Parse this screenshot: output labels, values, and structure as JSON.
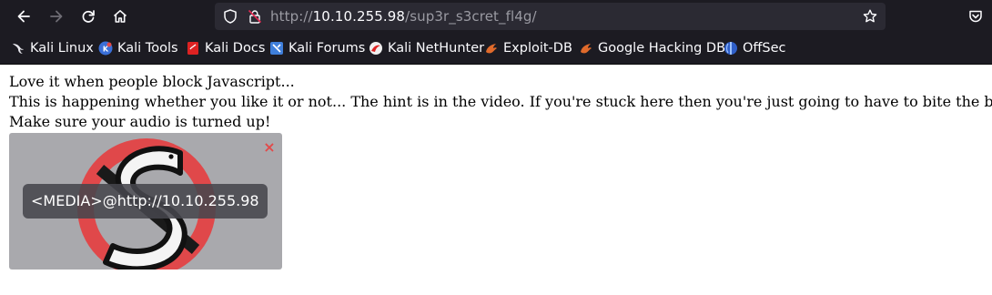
{
  "browser": {
    "url": {
      "scheme": "http://",
      "host": "10.10.255.98",
      "path": "/sup3r_s3cret_fl4g/"
    },
    "bookmarks": [
      {
        "label": "Kali Linux",
        "icon": "kali-dragon-icon"
      },
      {
        "label": "Kali Tools",
        "icon": "kali-tools-icon"
      },
      {
        "label": "Kali Docs",
        "icon": "kali-docs-icon"
      },
      {
        "label": "Kali Forums",
        "icon": "kali-forums-icon"
      },
      {
        "label": "Kali NetHunter",
        "icon": "kali-nethunter-icon"
      },
      {
        "label": "Exploit-DB",
        "icon": "exploit-db-icon"
      },
      {
        "label": "Google Hacking DB",
        "icon": "google-hacking-db-icon"
      },
      {
        "label": "OffSec",
        "icon": "offsec-icon"
      }
    ]
  },
  "page": {
    "lines": [
      "Love it when people block Javascript...",
      "This is happening whether you like it or not... The hint is in the video. If you're stuck here then you're just going to have to bite the bullet!",
      "Make sure your audio is turned up!"
    ],
    "media": {
      "label": "<MEDIA>@http://10.10.255.98",
      "close_glyph": "×"
    }
  },
  "colors": {
    "chrome_bg": "#1c1b22",
    "urlbar_bg": "#2b2a33",
    "media_bg": "#a9a9ad",
    "logo_red": "#e24a4a",
    "close_red": "#e24a4a"
  }
}
